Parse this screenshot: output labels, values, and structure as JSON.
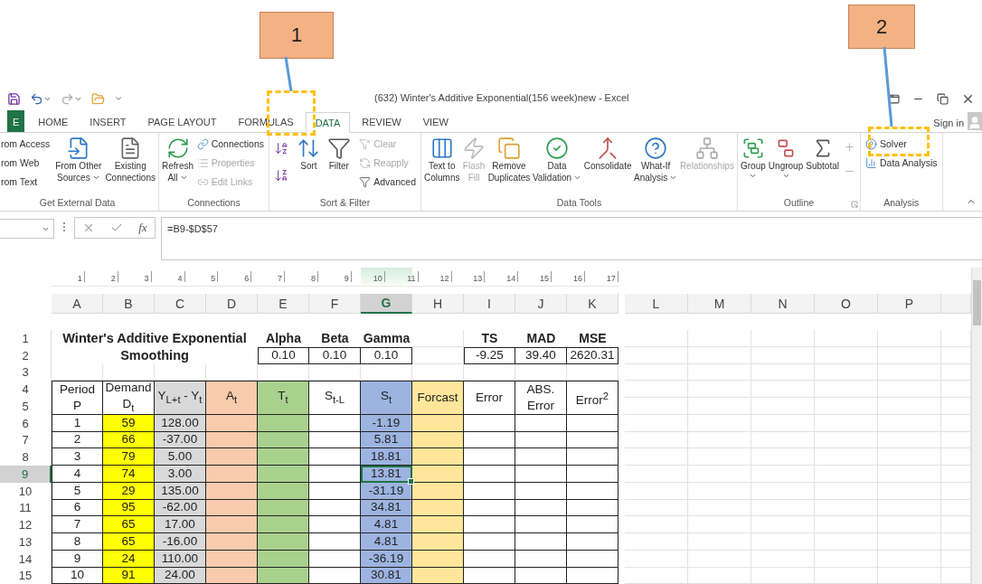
{
  "annotations": [
    {
      "label": "1"
    },
    {
      "label": "2"
    }
  ],
  "window": {
    "title": "(632) Winter's Additive Exponential(156 week)new - Excel"
  },
  "tabs": [
    {
      "label": "E",
      "selected": false,
      "kind": "file"
    },
    {
      "label": "HOME",
      "selected": false,
      "kind": "tab"
    },
    {
      "label": "INSERT",
      "selected": false,
      "kind": "tab"
    },
    {
      "label": "PAGE LAYOUT",
      "selected": false,
      "kind": "tab"
    },
    {
      "label": "FORMULAS",
      "selected": false,
      "kind": "tab"
    },
    {
      "label": "DATA",
      "selected": true,
      "kind": "tab"
    },
    {
      "label": "REVIEW",
      "selected": false,
      "kind": "tab"
    },
    {
      "label": "VIEW",
      "selected": false,
      "kind": "tab"
    }
  ],
  "account": {
    "label": "Sign in"
  },
  "ribbon": {
    "groups": [
      {
        "name": "Get External Data",
        "items": [
          {
            "kind": "stack",
            "entries": [
              {
                "label": "rom Access",
                "disabled": false
              },
              {
                "label": "rom Web",
                "disabled": false
              },
              {
                "label": "rom Text",
                "disabled": false
              }
            ]
          },
          {
            "kind": "large",
            "lines": [
              "From Other",
              "Sources"
            ],
            "dropdown": true,
            "disabled": false
          },
          {
            "kind": "large",
            "lines": [
              "Existing",
              "Connections"
            ],
            "disabled": false
          }
        ]
      },
      {
        "name": "Connections",
        "items": [
          {
            "kind": "large",
            "lines": [
              "Refresh",
              "All"
            ],
            "dropdown": true,
            "disabled": false
          },
          {
            "kind": "stack",
            "entries": [
              {
                "label": "Connections",
                "disabled": false
              },
              {
                "label": "Properties",
                "disabled": true
              },
              {
                "label": "Edit Links",
                "disabled": true
              }
            ]
          }
        ]
      },
      {
        "name": "Sort & Filter",
        "items": [
          {
            "kind": "sort-buttons"
          },
          {
            "kind": "large",
            "lines": [
              "Sort"
            ],
            "disabled": false
          },
          {
            "kind": "large",
            "lines": [
              "Filter"
            ],
            "disabled": false
          },
          {
            "kind": "stack",
            "entries": [
              {
                "label": "Clear",
                "disabled": true
              },
              {
                "label": "Reapply",
                "disabled": true
              },
              {
                "label": "Advanced",
                "disabled": false
              }
            ]
          }
        ]
      },
      {
        "name": "Data Tools",
        "items": [
          {
            "kind": "large",
            "lines": [
              "Text to",
              "Columns"
            ],
            "disabled": false
          },
          {
            "kind": "large",
            "lines": [
              "Flash",
              "Fill"
            ],
            "disabled": true
          },
          {
            "kind": "large",
            "lines": [
              "Remove",
              "Duplicates"
            ],
            "disabled": false
          },
          {
            "kind": "large",
            "lines": [
              "Data",
              "Validation"
            ],
            "dropdown": true,
            "disabled": false
          },
          {
            "kind": "large",
            "lines": [
              "Consolidate"
            ],
            "disabled": false
          },
          {
            "kind": "large",
            "lines": [
              "What-If",
              "Analysis"
            ],
            "dropdown": true,
            "disabled": false
          },
          {
            "kind": "large",
            "lines": [
              "Relationships"
            ],
            "disabled": true
          }
        ]
      },
      {
        "name": "Outline",
        "launcher": true,
        "items": [
          {
            "kind": "large",
            "lines": [
              "Group"
            ],
            "dropdown": true,
            "disabled": false
          },
          {
            "kind": "large",
            "lines": [
              "Ungroup"
            ],
            "dropdown": true,
            "disabled": false
          },
          {
            "kind": "large",
            "lines": [
              "Subtotal"
            ],
            "disabled": false
          },
          {
            "kind": "outline-buttons"
          }
        ]
      },
      {
        "name": "Analysis",
        "items": [
          {
            "kind": "stack",
            "entries": [
              {
                "label": "Solver",
                "disabled": false
              },
              {
                "label": "Data Analysis",
                "disabled": false
              }
            ]
          }
        ]
      }
    ]
  },
  "formula_bar": {
    "function_label": "fx",
    "formula": "=B9-$D$57"
  },
  "ruler": [
    "1",
    "2",
    "3",
    "4",
    "5",
    "6",
    "7",
    "8",
    "9",
    "10",
    "11",
    "12",
    "13",
    "14",
    "15",
    "16",
    "17"
  ],
  "columns": [
    {
      "label": "A",
      "selected": false
    },
    {
      "label": "B",
      "selected": false
    },
    {
      "label": "C",
      "selected": false
    },
    {
      "label": "D",
      "selected": false
    },
    {
      "label": "E",
      "selected": false
    },
    {
      "label": "F",
      "selected": false
    },
    {
      "label": "G",
      "selected": true
    },
    {
      "label": "H",
      "selected": false
    },
    {
      "label": "I",
      "selected": false
    },
    {
      "label": "J",
      "selected": false
    },
    {
      "label": "K",
      "selected": false
    },
    {
      "label": "L",
      "selected": false
    },
    {
      "label": "M",
      "selected": false
    },
    {
      "label": "N",
      "selected": false
    },
    {
      "label": "O",
      "selected": false
    },
    {
      "label": "P",
      "selected": false
    }
  ],
  "row_headers": [
    {
      "label": "1",
      "selected": false
    },
    {
      "label": "2",
      "selected": false
    },
    {
      "label": "3",
      "selected": false
    },
    {
      "label": "4",
      "selected": false
    },
    {
      "label": "5",
      "selected": false
    },
    {
      "label": "6",
      "selected": false
    },
    {
      "label": "7",
      "selected": false
    },
    {
      "label": "8",
      "selected": false
    },
    {
      "label": "9",
      "selected": true
    },
    {
      "label": "10",
      "selected": false
    },
    {
      "label": "11",
      "selected": false
    },
    {
      "label": "12",
      "selected": false
    },
    {
      "label": "13",
      "selected": false
    },
    {
      "label": "14",
      "selected": false
    },
    {
      "label": "15",
      "selected": false
    }
  ],
  "sheet": {
    "title": "Winter's Additive Exponential Smoothing",
    "parameters": [
      {
        "label": "Alpha",
        "value": "0.10"
      },
      {
        "label": "Beta",
        "value": "0.10"
      },
      {
        "label": "Gamma",
        "value": "0.10"
      }
    ],
    "metrics": [
      {
        "label": "TS",
        "value": "-9.25"
      },
      {
        "label": "MAD",
        "value": "39.40"
      },
      {
        "label": "MSE",
        "value": "2620.31"
      }
    ],
    "columns": [
      {
        "heading": {
          "lines": [
            "Period",
            "P"
          ],
          "color": "#ffffff"
        },
        "color": "#ffffff"
      },
      {
        "heading": {
          "lines": [
            "Demand",
            "D$_{t}$"
          ],
          "color": "#ffffff"
        },
        "color": "#ffff00"
      },
      {
        "heading": {
          "lines": [
            "Y$_{L+t}$ - Y$_{t}$"
          ],
          "color": "#d9d9d9"
        },
        "color": "#d9d9d9"
      },
      {
        "heading": {
          "lines": [
            "A$_{t}$"
          ],
          "color": "#f8cbad"
        },
        "color": "#f8cbad"
      },
      {
        "heading": {
          "lines": [
            "T$_{t}$"
          ],
          "color": "#a9d18e"
        },
        "color": "#a9d18e"
      },
      {
        "heading": {
          "lines": [
            "S$_{t-L}$"
          ],
          "color": "#ffffff"
        },
        "color": "#ffffff"
      },
      {
        "heading": {
          "lines": [
            "S$_{t}$"
          ],
          "color": "#9db4e0"
        },
        "color": "#9db4e0"
      },
      {
        "heading": {
          "lines": [
            "Forcast"
          ],
          "color": "#ffe699"
        },
        "color": "#ffe699"
      },
      {
        "heading": {
          "lines": [
            "Error"
          ],
          "color": "#ffffff"
        },
        "color": "#ffffff"
      },
      {
        "heading": {
          "lines": [
            "ABS.",
            "Error"
          ],
          "color": "#ffffff"
        },
        "color": "#ffffff"
      },
      {
        "heading": {
          "lines": [
            "Error$^{2}$"
          ],
          "color": "#ffffff"
        },
        "color": "#ffffff"
      }
    ],
    "rows": [
      {
        "period": "1",
        "demand": "59",
        "difference": "128.00",
        "s_t": "-1.19",
        "selected": false
      },
      {
        "period": "2",
        "demand": "66",
        "difference": "-37.00",
        "s_t": "5.81",
        "selected": false
      },
      {
        "period": "3",
        "demand": "79",
        "difference": "5.00",
        "s_t": "18.81",
        "selected": false
      },
      {
        "period": "4",
        "demand": "74",
        "difference": "3.00",
        "s_t": "13.81",
        "selected": true
      },
      {
        "period": "5",
        "demand": "29",
        "difference": "135.00",
        "s_t": "-31.19",
        "selected": false
      },
      {
        "period": "6",
        "demand": "95",
        "difference": "-62.00",
        "s_t": "34.81",
        "selected": false
      },
      {
        "period": "7",
        "demand": "65",
        "difference": "17.00",
        "s_t": "4.81",
        "selected": false
      },
      {
        "period": "8",
        "demand": "65",
        "difference": "-16.00",
        "s_t": "4.81",
        "selected": false
      },
      {
        "period": "9",
        "demand": "24",
        "difference": "110.00",
        "s_t": "-36.19",
        "selected": false
      },
      {
        "period": "10",
        "demand": "91",
        "difference": "24.00",
        "s_t": "30.81",
        "selected": false
      }
    ]
  }
}
